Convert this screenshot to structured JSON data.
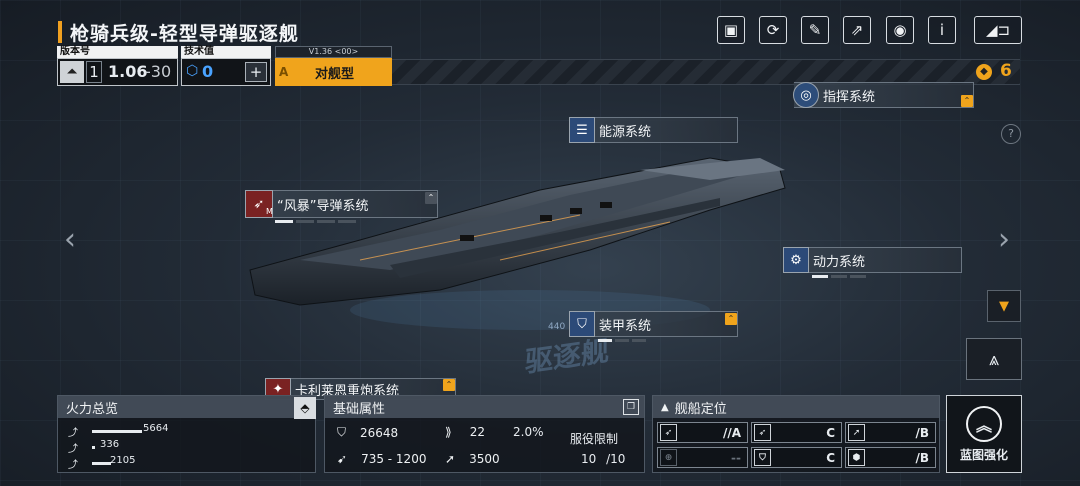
{
  "ship": {
    "title": "枪骑兵级-轻型导弹驱逐舰",
    "watermark_number": "440",
    "watermark_text": "驱逐舰"
  },
  "version_panel": {
    "label": "版本号",
    "tier": "1",
    "value": "1.06",
    "max": "30"
  },
  "tech_panel": {
    "label": "技术值",
    "value": "0",
    "add_icon": "plus-icon"
  },
  "role": {
    "version": "V1.36 <00>",
    "grade": "A",
    "type": "对舰型"
  },
  "resource": {
    "count": "6",
    "icon": "coin-icon"
  },
  "toolbar": [
    "image-export-icon",
    "refresh-icon",
    "paint-icon",
    "share-icon",
    "eye-icon",
    "info-icon",
    "back-icon"
  ],
  "help_icon": "?",
  "systems": {
    "command": {
      "label": "指挥系统",
      "badge": "⌃"
    },
    "energy": {
      "label": "能源系统"
    },
    "missile": {
      "label": "“风暴”导弹系统",
      "sub": "M",
      "badge": "⌃"
    },
    "power": {
      "label": "动力系统"
    },
    "armor": {
      "label": "装甲系统",
      "badge": "⌃"
    },
    "cannon": {
      "label": "卡利莱恩重炮系统",
      "badge": "⌃"
    }
  },
  "firepower": {
    "title": "火力总览",
    "rows": [
      {
        "value": "5664",
        "bar": 0.66
      },
      {
        "value": "336",
        "bar": 0.04
      },
      {
        "value": "2105",
        "bar": 0.25
      }
    ]
  },
  "base_attr": {
    "title": "基础属性",
    "hp": "26648",
    "armor": "22",
    "evasion": "2.0%",
    "speed": "735 - 1200",
    "warp": "3500",
    "service_label": "服役限制",
    "service_current": "10",
    "service_max": "/10"
  },
  "positioning": {
    "title": "舰船定位",
    "cells": [
      {
        "grade": "//A"
      },
      {
        "grade": "C"
      },
      {
        "grade": "/B"
      },
      {
        "grade": "--"
      },
      {
        "grade": "C"
      },
      {
        "grade": "/B"
      }
    ]
  },
  "enhance": {
    "label": "蓝图强化"
  },
  "colors": {
    "accent": "#f0a41c",
    "panel": "#12161c"
  }
}
